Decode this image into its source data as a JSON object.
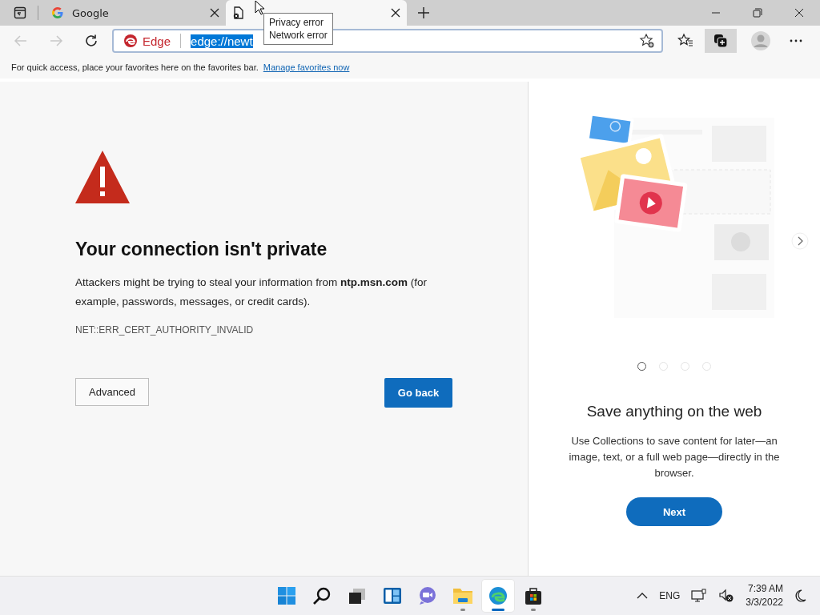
{
  "tabs": [
    {
      "kind": "google",
      "title": "Google",
      "selected": false
    },
    {
      "kind": "error",
      "selected": true
    }
  ],
  "tooltip": {
    "lines": [
      "Privacy error",
      "Network error"
    ]
  },
  "address": {
    "identity": "Edge",
    "url": "edge://newt",
    "url_selected": true
  },
  "favorites_bar": {
    "message": "For quick access, place your favorites here on the favorites bar.",
    "link": "Manage favorites now"
  },
  "error": {
    "heading": "Your connection isn't private",
    "body": "Attackers might be trying to steal your information from **ntp.msn.com** (for example, passwords, messages, or credit cards).",
    "code": "NET::ERR_CERT_AUTHORITY_INVALID",
    "advanced_button": "Advanced",
    "back_button": "Go back"
  },
  "panel": {
    "title": "Save anything on the web",
    "text": "Use Collections to save content for later—an image, text, or a full web page—directly in the browser.",
    "button": "Next",
    "dots": [
      {
        "selected": true
      },
      {
        "selected": false
      },
      {
        "selected": false
      },
      {
        "selected": false
      }
    ]
  },
  "taskbar": {
    "apps": [
      {
        "kind": "start",
        "open": false,
        "selected": false
      },
      {
        "kind": "search",
        "open": false,
        "selected": false
      },
      {
        "kind": "taskview",
        "open": false,
        "selected": false
      },
      {
        "kind": "widgets",
        "open": false,
        "selected": false
      },
      {
        "kind": "chat",
        "open": false,
        "selected": false
      },
      {
        "kind": "explorer",
        "open": true,
        "selected": false
      },
      {
        "kind": "edge",
        "open": true,
        "selected": true
      },
      {
        "kind": "store",
        "open": true,
        "selected": false
      }
    ],
    "language": "ENG",
    "time": "7:39 AM",
    "date": "3/3/2022"
  }
}
